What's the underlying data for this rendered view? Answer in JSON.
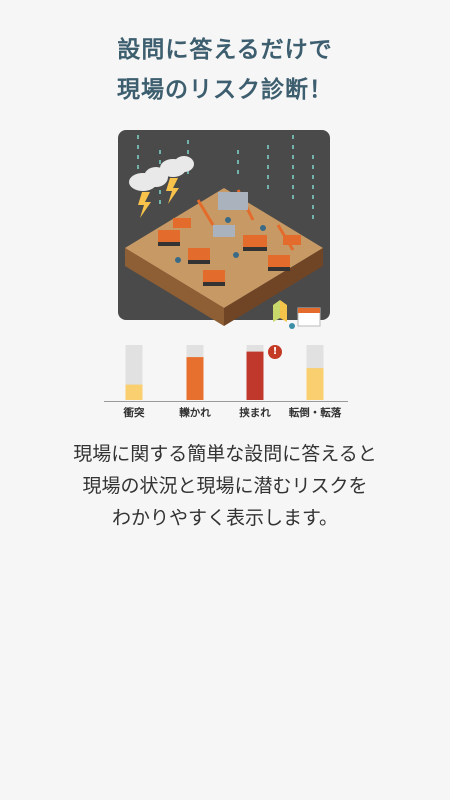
{
  "heading": {
    "line1": "設問に答えるだけで",
    "line2": "現場のリスク診断！"
  },
  "risk_chart": {
    "warning_mark": "!",
    "bars": [
      {
        "label": "衝突",
        "level": 0.28,
        "color": "#f9cf6f"
      },
      {
        "label": "轢かれ",
        "level": 0.78,
        "color": "#e8702f"
      },
      {
        "label": "挟まれ",
        "level": 0.88,
        "color": "#c0382b"
      },
      {
        "label": "転倒・転落",
        "level": 0.58,
        "color": "#f9cf6f"
      }
    ]
  },
  "description": {
    "line1": "現場に関する簡単な設問に答えると",
    "line2": "現場の状況と現場に潜むリスクを",
    "line3": "わかりやすく表示します。"
  },
  "colors": {
    "title": "#3d5e6e",
    "scene_bg": "#4a4a4a",
    "ground": "#b07c49",
    "machine": "#e36b2c"
  }
}
